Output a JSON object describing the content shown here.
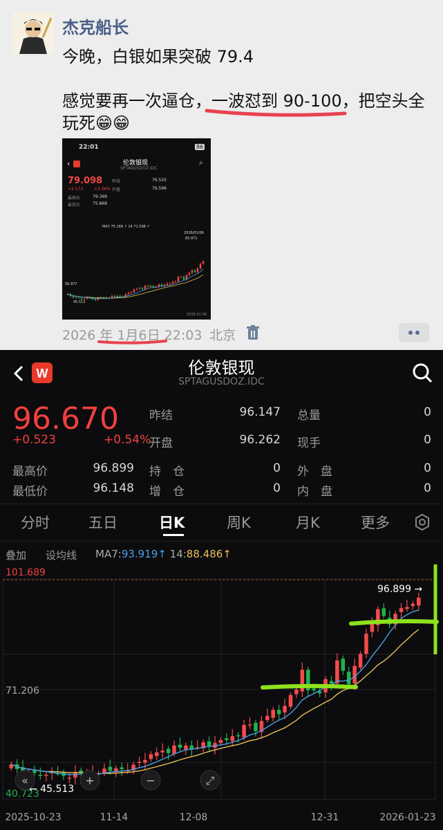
{
  "post": {
    "author": "杰克船长",
    "line1": "今晚，白银如果突破 79.4",
    "line2": "感觉要再一次逼仓，一波怼到 90-100，把空头全",
    "line3": "玩死😁😁",
    "timestamp": "2026 年 1月6日 22:03",
    "location": "北京"
  },
  "thumbnail": {
    "clock": "22:01",
    "battery": "86",
    "title": "伦敦银现",
    "subtitle": "SPTAGUSDOZ.IDC",
    "price": "79.098",
    "change": "+2.573",
    "change_pct": "+3.36%",
    "r1_l": "昨结",
    "r1_v": "76.525",
    "r2_l": "开盘",
    "r2_v": "76.596",
    "hi_l": "最高价",
    "hi_v": "79.369",
    "lo_l": "最低价",
    "lo_v": "75.869",
    "ma_text": "MA7 75.168 ↑ 14 71.598 ↑",
    "top_price": "83.971",
    "date_tag": "2026/01/06",
    "level_mid": "56.977",
    "level_low": "45.513",
    "axis_end": "2026-01-06"
  },
  "app": {
    "title": "伦敦银现",
    "symbol": "SPTAGUSDOZ.IDC",
    "price": "96.670",
    "change": "+0.523",
    "change_pct": "+0.54%",
    "stats": [
      {
        "label": "昨结",
        "value": "96.147"
      },
      {
        "label": "开盘",
        "value": "96.262"
      },
      {
        "label": "总量",
        "value": "0"
      },
      {
        "label": "现手",
        "value": "0"
      },
      {
        "label": "最高价",
        "value": "96.899"
      },
      {
        "label": "最低价",
        "value": "96.148"
      },
      {
        "label": "持　仓",
        "value": "0"
      },
      {
        "label": "增　仓",
        "value": "0"
      },
      {
        "label": "外　盘",
        "value": "0"
      },
      {
        "label": "内　盘",
        "value": "0"
      }
    ],
    "tabs": [
      "分时",
      "五日",
      "日K",
      "周K",
      "月K",
      "更多"
    ],
    "active_tab": "日K",
    "toolbar": {
      "overlay": "叠加",
      "set_ma": "设均线",
      "ma7_label": "MA7:",
      "ma7_value": "93.919↑",
      "ma14_label": "14:",
      "ma14_value": "88.486↑"
    }
  },
  "chart_data": {
    "type": "candlestick",
    "y_top_label": "101.689",
    "y_mid_label": "71.206",
    "y_low_label": "40.723",
    "ylim": [
      40.723,
      101.689
    ],
    "annotation_high": "96.899",
    "annotation_low": "45.513",
    "x_ticks": [
      "2025-10-23",
      "11-14",
      "12-08",
      "12-31",
      "2026-01-23"
    ],
    "series": [
      {
        "name": "MA7",
        "color": "#4a9ee8"
      },
      {
        "name": "MA14",
        "color": "#e8c05a"
      }
    ],
    "candles_close_approx": [
      50.5,
      49.2,
      48.4,
      48.5,
      48.1,
      47.3,
      47.6,
      48.3,
      48.0,
      47.3,
      46.8,
      48.3,
      48.0,
      47.8,
      48.2,
      48.0,
      49.3,
      48.7,
      49.4,
      49.1,
      48.8,
      50.4,
      51.2,
      51.7,
      53.3,
      53.8,
      54.3,
      53.6,
      55.7,
      55.1,
      55.7,
      54.6,
      55.2,
      56.6,
      55.6,
      56.4,
      57.2,
      57.2,
      58.3,
      58.4,
      61.4,
      61.5,
      59.7,
      62.5,
      63.9,
      65.6,
      64.4,
      66.7,
      69.7,
      71.2,
      76.7,
      71.0,
      71.0,
      70.2,
      74.1,
      72.9,
      79.3,
      76.4,
      72.7,
      77.8,
      81.1,
      86.7,
      89.3,
      93.5,
      91.6,
      89.3,
      92.2,
      93.8,
      94.1,
      95.0,
      96.7
    ],
    "colors": {
      "up": "#f24b4b",
      "down": "#22b14c"
    }
  }
}
